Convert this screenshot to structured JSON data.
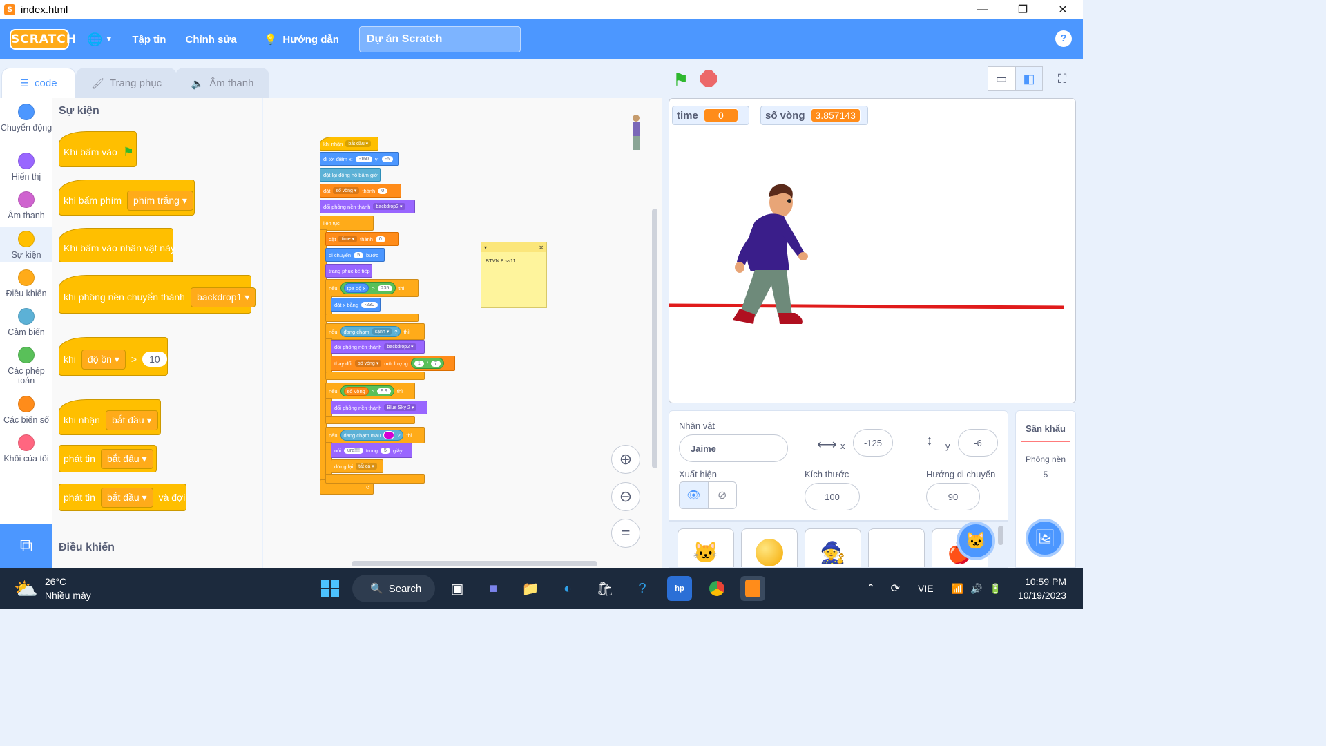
{
  "window": {
    "title": "index.html",
    "controls": [
      "—",
      "❐",
      "✕"
    ]
  },
  "menu": {
    "logo": "SCRATCH",
    "file": "Tập tin",
    "edit": "Chỉnh sửa",
    "tutorials": "Hướng dẫn",
    "project_title": "Dự án Scratch",
    "help": "?"
  },
  "tabs": {
    "code": "code",
    "costumes": "Trang phục",
    "sounds": "Âm thanh"
  },
  "categories": [
    {
      "label": "Chuyển động",
      "color": "#4c97ff"
    },
    {
      "label": "Hiển thị",
      "color": "#9966ff"
    },
    {
      "label": "Âm thanh",
      "color": "#cf63cf"
    },
    {
      "label": "Sự kiện",
      "color": "#ffbf00"
    },
    {
      "label": "Điều khiển",
      "color": "#ffab19"
    },
    {
      "label": "Cảm biến",
      "color": "#5cb1d6"
    },
    {
      "label": "Các phép toán",
      "color": "#59c059"
    },
    {
      "label": "Các biến số",
      "color": "#ff8c1a"
    },
    {
      "label": "Khối của tôi",
      "color": "#ff6680"
    }
  ],
  "palette": {
    "heading_events": "Sự kiện",
    "heading_control": "Điều khiển",
    "when_flag": "Khi bấm vào",
    "when_key": "khi bấm phím",
    "key_value": "phím trắng",
    "when_sprite_clicked": "Khi bấm vào nhân vật này",
    "when_backdrop": "khi phông nền chuyển thành",
    "backdrop_value": "backdrop1",
    "when_word": "khi",
    "loudness": "độ ồn",
    "gt": ">",
    "threshold": "10",
    "when_receive": "khi nhận",
    "msg_start": "bắt đầu",
    "broadcast": "phát tin",
    "broadcast_msg": "bắt đầu",
    "broadcast_wait": "phát tin",
    "broadcast_wait_msg": "bắt đầu",
    "and_wait": "và đợi"
  },
  "script": {
    "hat": "khi nhận",
    "hat_msg": "bắt đầu",
    "goto": "đi tới điểm x:",
    "goto_x": "-160",
    "goto_y_lbl": "y:",
    "goto_y": "-6",
    "reset_timer": "đặt lại đồng hồ bấm giờ",
    "set1": "đặt",
    "set1_var": "số vòng",
    "set1_to": "thành",
    "set1_val": "0",
    "switch1": "đổi phông nền thành",
    "switch1_val": "backdrop2",
    "forever": "liên tục",
    "set2": "đặt",
    "set2_var": "time",
    "set2_to": "thành",
    "set2_val": "0",
    "move": "di chuyển",
    "move_val": "5",
    "move_unit": "bước",
    "next_costume": "trang phục kế tiếp",
    "if1": "nếu",
    "if1_rep": "tọa độ x",
    "if1_op": ">",
    "if1_val": "235",
    "if1_then": "thì",
    "setx": "đặt x bằng",
    "setx_val": "-230",
    "if2": "nếu",
    "if2_touch": "đang chạm",
    "if2_obj": "cạnh",
    "if2_q": "?",
    "if2_then": "thì",
    "switch2": "đổi phông nền thành",
    "switch2_val": "backdrop2",
    "change": "thay đổi",
    "change_var": "số vòng",
    "change_by": "một lượng",
    "change_a": "1",
    "change_div": "/",
    "change_b": "7",
    "if3": "nếu",
    "if3_var": "số vòng",
    "if3_op": ">",
    "if3_val": "9.9",
    "if3_then": "thì",
    "switch3": "đổi phông nền thành",
    "switch3_val": "Blue Sky 2",
    "if4": "nếu",
    "if4_touch": "đang chạm màu",
    "if4_q": "?",
    "if4_then": "thì",
    "say": "nói",
    "say_msg": "ura!!!!",
    "say_for": "trong",
    "say_secs": "5",
    "say_unit": "giây",
    "stop": "dừng lại",
    "stop_val": "tất cả",
    "loop_arrow": "↺"
  },
  "note": {
    "text": "BTVN 8 ss11",
    "collapse": "▾",
    "close": "✕"
  },
  "monitors": [
    {
      "name": "time",
      "value": "0"
    },
    {
      "name": "số vòng",
      "value": "3.857143"
    }
  ],
  "sprite": {
    "label": "Nhân vật",
    "name": "Jaime",
    "x_label": "x",
    "x": "-125",
    "y_label": "y",
    "y": "-6",
    "show_label": "Xuất hiện",
    "size_label": "Kích thước",
    "size": "100",
    "direction_label": "Hướng di chuyển",
    "direction": "90"
  },
  "stage_pane": {
    "title": "Sân khấu",
    "backdrops_label": "Phông nền",
    "backdrops_count": "5"
  },
  "taskbar": {
    "temp": "26°C",
    "weather": "Nhiều mây",
    "search": "Search",
    "lang": "VIE",
    "time": "10:59 PM",
    "date": "10/19/2023"
  },
  "colors": {
    "accent": "#4c97ff",
    "events": "#ffbf00",
    "control": "#ffab19",
    "variables": "#ff8c1a"
  }
}
